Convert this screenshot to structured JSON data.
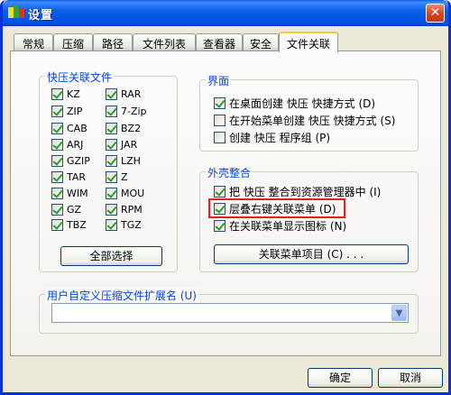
{
  "window": {
    "title": "设置",
    "close_glyph": "✕"
  },
  "tabs": [
    {
      "label": "常规"
    },
    {
      "label": "压缩"
    },
    {
      "label": "路径"
    },
    {
      "label": "文件列表"
    },
    {
      "label": "查看器"
    },
    {
      "label": "安全"
    },
    {
      "label": "文件关联",
      "active": true
    }
  ],
  "quick_assoc": {
    "title": "快压关联文件",
    "left": [
      {
        "label": "KZ",
        "checked": true
      },
      {
        "label": "ZIP",
        "checked": true
      },
      {
        "label": "CAB",
        "checked": true
      },
      {
        "label": "ARJ",
        "checked": true
      },
      {
        "label": "GZIP",
        "checked": true
      },
      {
        "label": "TAR",
        "checked": true
      },
      {
        "label": "WIM",
        "checked": true
      },
      {
        "label": "GZ",
        "checked": true
      },
      {
        "label": "TBZ",
        "checked": true
      }
    ],
    "right": [
      {
        "label": "RAR",
        "checked": true
      },
      {
        "label": "7-Zip",
        "checked": true
      },
      {
        "label": "BZ2",
        "checked": true
      },
      {
        "label": "JAR",
        "checked": true
      },
      {
        "label": "LZH",
        "checked": true
      },
      {
        "label": "Z",
        "checked": true
      },
      {
        "label": "MOU",
        "checked": true
      },
      {
        "label": "RPM",
        "checked": true
      },
      {
        "label": "TGZ",
        "checked": true
      }
    ],
    "select_all": "全部选择"
  },
  "interface": {
    "title": "界面",
    "options": [
      {
        "label": "在桌面创建 快压 快捷方式 (D)",
        "checked": true
      },
      {
        "label": "在开始菜单创建 快压 快捷方式 (S)",
        "checked": false
      },
      {
        "label": "创建 快压 程序组 (P)",
        "checked": false
      }
    ]
  },
  "shell": {
    "title": "外壳整合",
    "options": [
      {
        "label": "把 快压 整合到资源管理器中 (I)",
        "checked": true
      },
      {
        "label": "层叠右键关联菜单 (D)",
        "checked": true
      },
      {
        "label": "在关联菜单显示图标 (N)",
        "checked": true
      }
    ],
    "menu_items_button": "关联菜单项目 (C) . . ."
  },
  "custom_ext": {
    "title": "用户自定义压缩文件扩展名 (U)",
    "value": ""
  },
  "footer": {
    "ok": "确定",
    "cancel": "取消"
  },
  "colors": {
    "accent": "#0046d5",
    "highlight": "#e02020",
    "titlebar": "#0050e6"
  }
}
